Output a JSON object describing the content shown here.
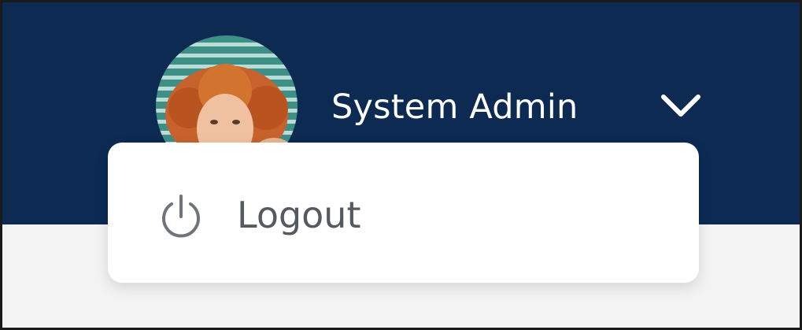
{
  "header": {
    "user_name": "System Admin",
    "avatar_icon": "user-avatar-photo",
    "menu_toggle_icon": "chevron-down-icon",
    "background_color": "#0d2a53"
  },
  "user_menu": {
    "items": [
      {
        "label": "Logout",
        "icon": "power-icon"
      }
    ]
  }
}
